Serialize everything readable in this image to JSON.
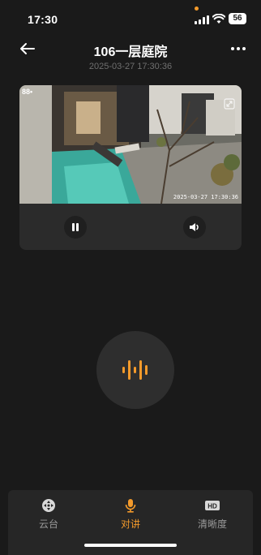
{
  "status_bar": {
    "time": "17:30",
    "battery": "56",
    "icons": [
      "cellular-signal-icon",
      "wifi-icon",
      "battery-icon"
    ]
  },
  "header": {
    "title": "106一层庭院",
    "subtitle": "2025-03-27 17:30:36",
    "back_icon": "arrow-left-icon",
    "more_icon": "more-dots-icon"
  },
  "video": {
    "logo_text": "88•",
    "timestamp": "2025-03-27 17:30:36",
    "fullscreen_icon": "fullscreen-icon"
  },
  "controls": {
    "pause_icon": "pause-icon",
    "volume_icon": "speaker-icon"
  },
  "talk": {
    "icon": "voice-wave-icon"
  },
  "tabs": [
    {
      "label": "云台",
      "icon": "ptz-icon",
      "active": false
    },
    {
      "label": "对讲",
      "icon": "microphone-icon",
      "active": true
    },
    {
      "label": "清晰度",
      "icon": "hd-icon",
      "active": false
    }
  ],
  "colors": {
    "accent": "#f39a2b",
    "background": "#1a1a1a",
    "card": "#2b2b2b",
    "tabbar": "#262626",
    "inactive_text": "#9a9a9a"
  }
}
